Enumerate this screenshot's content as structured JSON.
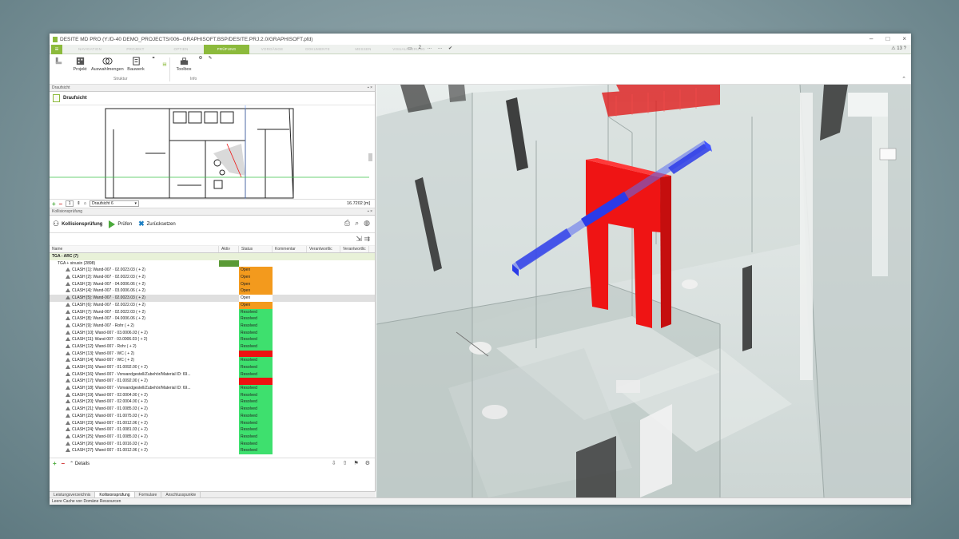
{
  "window": {
    "title": "DESITE MD PRO (Y:/D-40 DEMO_PROJECTS/006--GRAPHISOFT.BSP/DESITE.PRJ.2.0/GRAPHISOFT.pfd)"
  },
  "menu": {
    "tabs": [
      "NAVIGATION",
      "PROJEKT",
      "OPTIEN",
      "PRÜFUNG",
      "VORGÄNGE",
      "DOKUMENTE",
      "MESSEN",
      "VISUALISIERUNG"
    ],
    "active_tab": "PRÜFUNG",
    "right_items": [
      "2",
      "...",
      "..."
    ],
    "far_right": "13"
  },
  "ribbon": {
    "buttons": [
      "Projekt",
      "Auswahlmengen",
      "Bauwerk",
      "Toolbox"
    ],
    "groups": [
      "Struktur",
      "Info"
    ]
  },
  "draufsicht": {
    "panel_title": "Draufsicht",
    "header": "Draufsicht",
    "page_value": "1",
    "selected_view": "Draufsicht 6",
    "scale": "16.7202 [m]"
  },
  "kollision": {
    "panel_title": "Kollisionsprüfung",
    "title_button": "Kollisionsprüfung",
    "pruefen": "Prüfen",
    "zuruecksetzen": "Zurücksetzen",
    "columns": [
      "Name",
      "Aktiv",
      "Status",
      "Kommentar",
      "Verantwortlic",
      "Verantwortlic"
    ],
    "rows": [
      {
        "type": "group",
        "name": "TGA - ARC (7)",
        "status": "",
        "cls": "st-white"
      },
      {
        "type": "sub",
        "name": "TGA + sinusin (2898)",
        "status": "",
        "cls": "st-white"
      },
      {
        "type": "item",
        "name": "CLASH [1]: Wand-007 · 02.0023.03 ( + 2)",
        "status": "Open",
        "cls": "st-open"
      },
      {
        "type": "item",
        "name": "CLASH [2]: Wand-007 · 02.0022.03 ( + 2)",
        "status": "Open",
        "cls": "st-open"
      },
      {
        "type": "item",
        "name": "CLASH [3]: Wand-007 · 04.0006.06 ( + 2)",
        "status": "Open",
        "cls": "st-open"
      },
      {
        "type": "item",
        "name": "CLASH [4]: Wand-007 · 03.0006.06 ( + 2)",
        "status": "Open",
        "cls": "st-open"
      },
      {
        "type": "item hl",
        "name": "CLASH [5]: Wand-007 · 02.0023.03 ( + 2)",
        "status": "Open",
        "cls": "st-white"
      },
      {
        "type": "item",
        "name": "CLASH [6]: Wand-007 · 02.0022.03 ( + 2)",
        "status": "Open",
        "cls": "st-open"
      },
      {
        "type": "item",
        "name": "CLASH [7]: Wand-007 · 02.0022.03 ( + 2)",
        "status": "Resolved",
        "cls": "st-res"
      },
      {
        "type": "item",
        "name": "CLASH [8]: Wand-007 · 04.0006.06 ( + 2)",
        "status": "Resolved",
        "cls": "st-res"
      },
      {
        "type": "item",
        "name": "CLASH [9]: Wand-007 · Rohr ( + 2)",
        "status": "Resolved",
        "cls": "st-res"
      },
      {
        "type": "item",
        "name": "CLASH [10]: Wand-007 · 03.0006.03 ( + 2)",
        "status": "Resolved",
        "cls": "st-res"
      },
      {
        "type": "item",
        "name": "CLASH [11]: Wand-007 · 03.0006.03 ( + 2)",
        "status": "Resolved",
        "cls": "st-res"
      },
      {
        "type": "item",
        "name": "CLASH [12]: Wand-007 · Rohr ( + 2)",
        "status": "Resolved",
        "cls": "st-res"
      },
      {
        "type": "item",
        "name": "CLASH [13]: Wand-007 · WC ( + 2)",
        "status": "",
        "cls": "st-red"
      },
      {
        "type": "item",
        "name": "CLASH [14]: Wand-007 · WC ( + 2)",
        "status": "Resolved",
        "cls": "st-res"
      },
      {
        "type": "item",
        "name": "CLASH [15]: Wand-007 · 01.0092.00 ( + 2)",
        "status": "Resolved",
        "cls": "st-res"
      },
      {
        "type": "item",
        "name": "CLASH [16]: Wand-007 · Vorwandgestell/Zubehör/Material ID: 69...",
        "status": "Resolved",
        "cls": "st-res"
      },
      {
        "type": "item",
        "name": "CLASH [17]: Wand-007 · 01.0092.00 ( + 2)",
        "status": "",
        "cls": "st-red"
      },
      {
        "type": "item",
        "name": "CLASH [18]: Wand-007 · Vorwandgestell/Zubehör/Material ID: 69...",
        "status": "Resolved",
        "cls": "st-res"
      },
      {
        "type": "item",
        "name": "CLASH [19]: Wand-007 · 02.0004.00 ( + 2)",
        "status": "Resolved",
        "cls": "st-res"
      },
      {
        "type": "item",
        "name": "CLASH [20]: Wand-007 · 02.0004.00 ( + 2)",
        "status": "Resolved",
        "cls": "st-res"
      },
      {
        "type": "item",
        "name": "CLASH [21]: Wand-007 · 01.0085.03 ( + 2)",
        "status": "Resolved",
        "cls": "st-res"
      },
      {
        "type": "item",
        "name": "CLASH [22]: Wand-007 · 01.0075.03 ( + 2)",
        "status": "Resolved",
        "cls": "st-res"
      },
      {
        "type": "item",
        "name": "CLASH [23]: Wand-007 · 01.0012.06 ( + 2)",
        "status": "Resolved",
        "cls": "st-res"
      },
      {
        "type": "item",
        "name": "CLASH [24]: Wand-007 · 01.0081.03 ( + 2)",
        "status": "Resolved",
        "cls": "st-res"
      },
      {
        "type": "item",
        "name": "CLASH [25]: Wand-007 · 01.0085.03 ( + 2)",
        "status": "Resolved",
        "cls": "st-res"
      },
      {
        "type": "item",
        "name": "CLASH [26]: Wand-007 · 01.0016.03 ( + 2)",
        "status": "Resolved",
        "cls": "st-res"
      },
      {
        "type": "item",
        "name": "CLASH [27]: Wand-007 · 01.0012.06 ( + 2)",
        "status": "Resolved",
        "cls": "st-res"
      }
    ],
    "details": "Details"
  },
  "bottom_tabs": [
    "Leistungsverzeichnis",
    "Kollisionsprüfung",
    "Formulare",
    "Anschlusspunkte"
  ],
  "active_bottom_tab": "Kollisionsprüfung",
  "status_bar": "Leere Cache von Domäne Ressourcen",
  "colors": {
    "accent": "#8cba3c",
    "open": "#f39a1d",
    "resolved": "#3ee06e",
    "critical": "#e11111",
    "clash_wall": "#e01010",
    "pipe": "#2b3be8"
  }
}
